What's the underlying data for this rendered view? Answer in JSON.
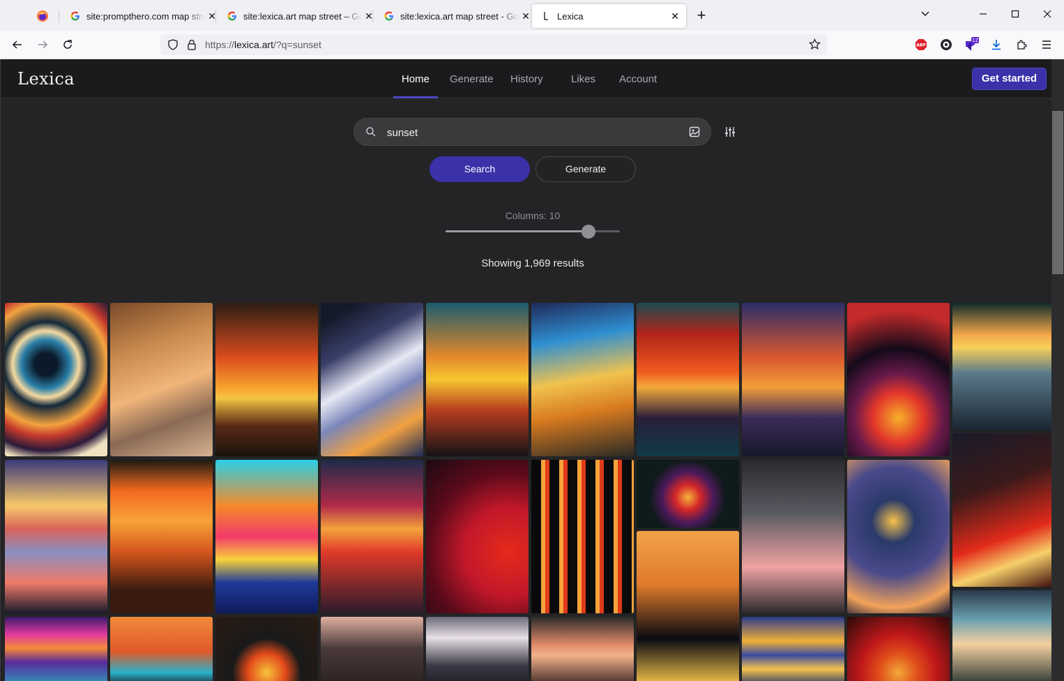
{
  "browser": {
    "tabs": [
      {
        "title": "site:prompthero.com map street",
        "icon": "google-icon"
      },
      {
        "title": "site:lexica.art map street – Google",
        "icon": "google-icon"
      },
      {
        "title": "site:lexica.art map street - Google",
        "icon": "google-icon"
      },
      {
        "title": "Lexica",
        "icon": "lexica-icon",
        "active": true
      }
    ],
    "url_prefix": "https://",
    "url_host": "lexica.art",
    "url_path": "/?q=sunset",
    "extension_badge": "12"
  },
  "site": {
    "logo": "Lexica",
    "nav": [
      "Home",
      "Generate",
      "History",
      "Likes",
      "Account"
    ],
    "active_nav": "Home",
    "cta_label": "Get started"
  },
  "search": {
    "query": "sunset",
    "search_label": "Search",
    "generate_label": "Generate"
  },
  "columns": {
    "label": "Columns: 10",
    "value": 10,
    "fraction": 0.82
  },
  "results_text": "Showing 1,969 results",
  "colors": {
    "accent": "#3b31a8",
    "page_bg": "#242426",
    "header_bg": "#1b1b1d"
  },
  "gallery": [
    {
      "g": "radial-gradient(circle at 40% 40%, #0b1a2a 10%, #2a7fa8 22%, #f5d9a0 30%, #13283a 38%, #f4a340 55%, #c33a2c 65%, #2b1a3a 78%, #f0e2c0 88%)"
    },
    {
      "g": "linear-gradient(160deg, #7a4a2a 0%, #c98a4d 30%, #f1b57a 55%, #8a6a55 75%, #d7b291 100%)"
    },
    {
      "g": "linear-gradient(180deg, #2a1d14 0%, #d94a1d 35%, #f7a12e 55%, #f4c542 62%, #5a2b16 80%, #1a120d 100%)"
    },
    {
      "g": "linear-gradient(150deg, #141a2a 10%, #3a3f6a 30%, #e7e9f4 48%, #7b86b9 62%, #f2a141 80%, #1d2a55 100%)"
    },
    {
      "g": "linear-gradient(180deg, #1b5b6e 0%, #e3882b 35%, #f7c631 50%, #b73d1e 70%, #141216 100%)"
    },
    {
      "g": "linear-gradient(170deg, #1f2a5a 0%, #2f8fd1 25%, #f1c24e 50%, #d77a1f 70%, #2a2a25 100%)"
    },
    {
      "g": "linear-gradient(180deg, #1b4a52 0%, #b0241a 20%, #f05a1f 45%, #f4a93c 55%, #2a1e3a 75%, #0f3a45 100%)"
    },
    {
      "g": "linear-gradient(180deg, #2a2e6a 0%, #d7562f 35%, #f29d3a 55%, #3b2a5a 75%, #16182a 100%)"
    },
    {
      "g": "radial-gradient(circle at 50% 75%, #f7b12a 0%, #e2362a 20%, #6a1a4a 35%, #140a1a 55%, #c32a2a 85%)"
    },
    {
      "g": "linear-gradient(180deg, #0f2a2a 0%, #f2a84a 25%, #f8d05a 35%, #5a7a8a 55%, #1a2430 100%)"
    },
    {
      "g": "linear-gradient(180deg, #3a3a7a 0%, #f7c86a 30%, #d8635a 45%, #8a8fc0 60%, #f07a6a 80%, #1a1a2a 100%)"
    },
    {
      "g": "linear-gradient(180deg, #1e1a12 0%, #f26a1f 20%, #f7a23a 40%, #d5561d 60%, #3a1a0f 85%)"
    },
    {
      "g": "linear-gradient(180deg, #2ad0e8 0%, #f58a2a 30%, #f23a6a 50%, #f7d33a 65%, #1f3a9a 80%, #101a5a 100%)"
    },
    {
      "g": "linear-gradient(180deg, #1f2a4a 0%, #b22a4a 30%, #f4a23a 45%, #e03a2a 60%, #2a1a2a 100%)"
    },
    {
      "g": "radial-gradient(circle at 80% 60%, #e52a1a 0%, #c3182a 35%, #5a0a1a 65%, #1a0a12 100%)"
    },
    {
      "g": "repeating-linear-gradient(90deg, #0a0a0a 0 14px, #f7a23a 14px 20px, #e03a1a 20px 26px)"
    },
    {
      "g": "radial-gradient(circle at 50% 55%, #f7b23a 0%, #d3262a 20%, #4a1a5a 40%, #0f1a1a 60%)"
    },
    {
      "g": "linear-gradient(180deg, #2a2a2e 0%, #5a5a62 35%, #f0a2a2 70%, #2a2a2e 100%)"
    },
    {
      "g": "radial-gradient(circle at 45% 40%, #f7c24a 0%, #2a3a6a 20%, #4a4a8a 50%, #f2a25a 80%, #1a1a3a 100%)"
    },
    {
      "g": "linear-gradient(160deg, #1a1a2a 0%, #3a1a1a 35%, #e22a1a 65%, #f7d06a 80%, #3a0a0a 100%)"
    },
    {
      "g": "linear-gradient(180deg, #3a1a6a 0%, #e03aa0 25%, #f58a3a 45%, #5a2a9a 65%, #2aa0c0 100%)"
    },
    {
      "g": "linear-gradient(180deg, #f28a3a 0%, #e05a2a 50%, #2ab0c8 80%, #1a1a2a 100%)"
    },
    {
      "g": "radial-gradient(circle at 50% 80%, #f7c33a 0%, #e24a1a 25%, #1a1a1a 45%, #2a1a12 100%)"
    },
    {
      "g": "linear-gradient(180deg, #e0b0a0 0%, #4a3a3a 45%, #2a2020 100%)"
    },
    {
      "g": "linear-gradient(180deg, #6a6a7a 0%, #e8e0e6 30%, #3a3a46 70%, #1a1a22 100%)"
    },
    {
      "g": "linear-gradient(180deg, #2a2a2a 0%, #e08a6a 40%, #f2b28a 55%, #3a2220 100%)"
    },
    {
      "g": "linear-gradient(180deg, #f2a24a 0%, #e07a2a 35%, #0a0a12 70%, #f2c24a 100%)"
    },
    {
      "g": "linear-gradient(180deg, #2a3a8a 0%, #f2b03a 35%, #3a4aa0 55%, #f4c24a 75%, #1a2a6a 100%)"
    },
    {
      "g": "radial-gradient(circle at 50% 80%, #f2a83a 0%, #e0501a 25%, #c0181a 50%, #2a0a0a 100%)"
    },
    {
      "g": "linear-gradient(180deg, #2a3a4a 0%, #6aa0b0 30%, #f4d0a0 55%, #1a2a2a 100%)"
    }
  ]
}
